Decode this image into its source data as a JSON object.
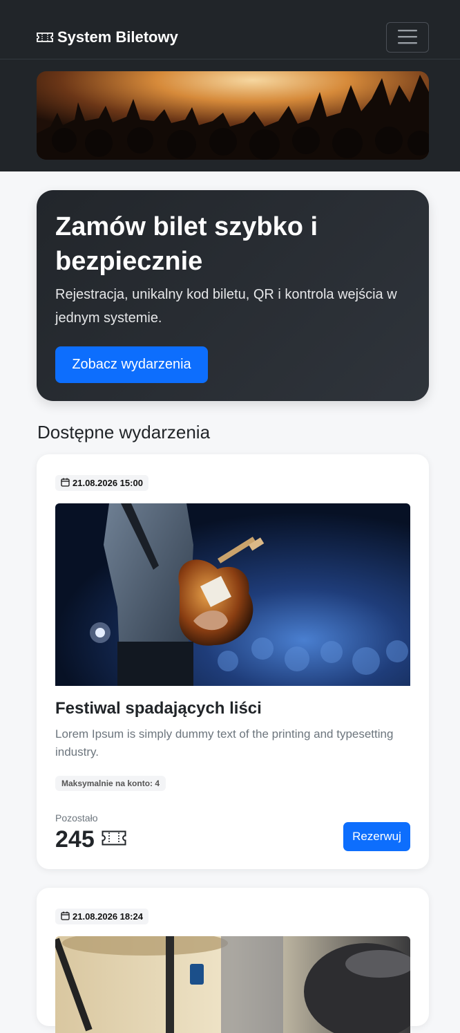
{
  "navbar": {
    "brand": "System Biletowy",
    "brand_icon": "ticket-icon",
    "toggler_icon": "hamburger-icon"
  },
  "hero": {
    "title": "Zamów bilet szybko i bezpiecznie",
    "subtitle": "Rejestracja, unikalny kod biletu, QR i kontrola wejścia w jednym systemie.",
    "cta_label": "Zobacz wydarzenia"
  },
  "events_section": {
    "title": "Dostępne wydarzenia",
    "events": [
      {
        "date": "21.08.2026 15:00",
        "title": "Festiwal spadających liści",
        "description": "Lorem Ipsum is simply dummy text of the printing and typesetting industry.",
        "limit_label": "Maksymalnie na konto: 4",
        "remaining_label": "Pozostało",
        "remaining_count": "245",
        "reserve_label": "Rezerwuj"
      },
      {
        "date": "21.08.2026 18:24"
      }
    ]
  },
  "colors": {
    "primary": "#0d6efd",
    "dark": "#212529",
    "background": "#f6f7f9"
  }
}
